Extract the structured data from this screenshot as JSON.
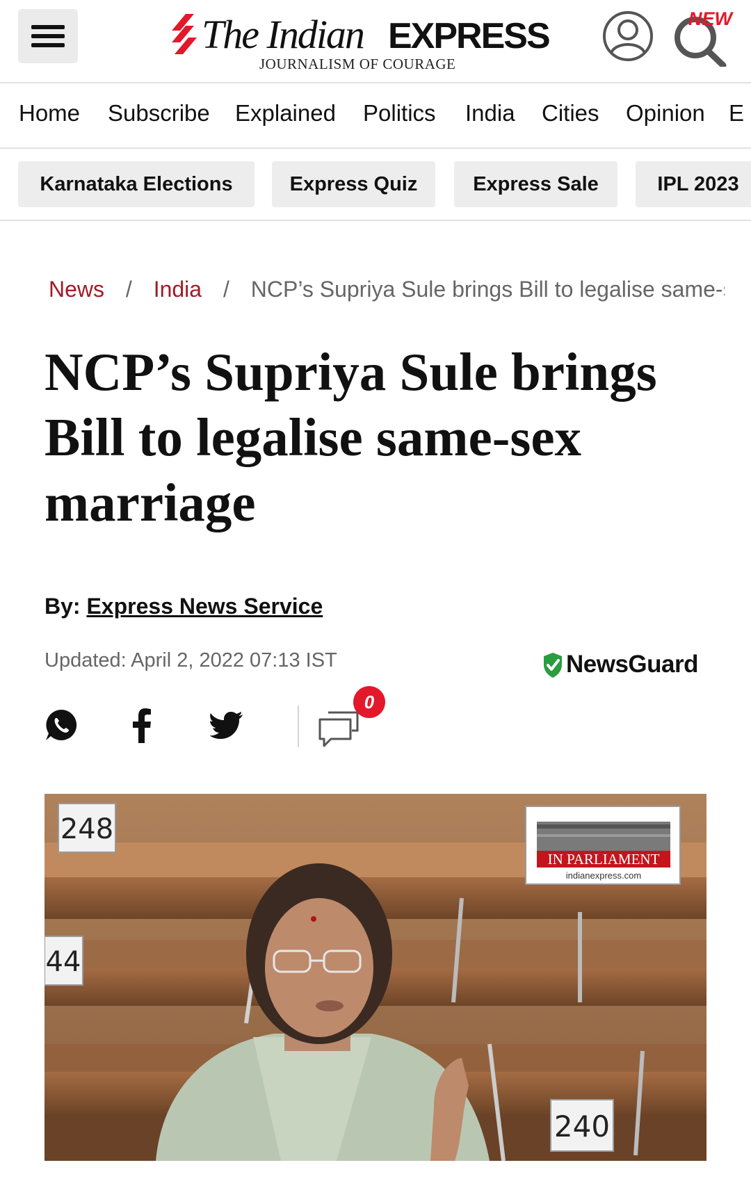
{
  "header": {
    "logo_the": "The Indian",
    "logo_express": "EXPRESS",
    "tagline": "JOURNALISM OF COURAGE",
    "new_badge": "NEW",
    "brand_red": "#e3182a",
    "icons": [
      "menu-icon",
      "user-account-icon",
      "search-icon"
    ]
  },
  "nav": {
    "items": [
      "Home",
      "Subscribe",
      "Explained",
      "Politics",
      "India",
      "Cities",
      "Opinion",
      "E"
    ]
  },
  "chips": [
    "Karnataka Elections",
    "Express Quiz",
    "Express Sale",
    "IPL 2023"
  ],
  "breadcrumb": {
    "items": [
      "News",
      "India"
    ],
    "separator": "/",
    "current": "NCP’s Supriya Sule brings Bill to legalise same-s",
    "link_color": "#a11b26"
  },
  "article": {
    "headline": "NCP’s Supriya Sule brings Bill to legalise same-sex marriage",
    "byline_label": "By:",
    "author": "Express News Service",
    "updated": "Updated: April 2, 2022 07:13 IST",
    "newsguard_label": "NewsGuard",
    "newsguard_color": "#2a9d3f",
    "share_icons": [
      "whatsapp-icon",
      "facebook-icon",
      "twitter-icon",
      "comment-icon"
    ],
    "comment_count": "0"
  },
  "photo": {
    "seat_numbers": [
      "248",
      "44",
      "240"
    ],
    "overlay_title": "IN PARLIAMENT",
    "overlay_site": "indianexpress.com"
  }
}
